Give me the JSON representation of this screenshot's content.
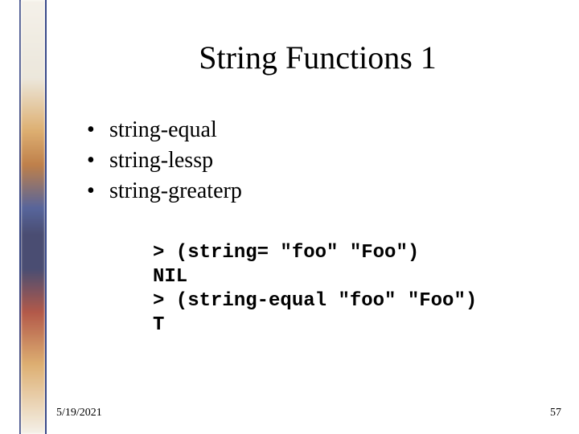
{
  "title": "String Functions 1",
  "bullets": [
    "string-equal",
    "string-lessp",
    "string-greaterp"
  ],
  "code_lines": [
    "> (string= \"foo\" \"Foo\")",
    "NIL",
    "> (string-equal \"foo\" \"Foo\")",
    "T"
  ],
  "footer": {
    "date": "5/19/2021",
    "page": "57"
  }
}
